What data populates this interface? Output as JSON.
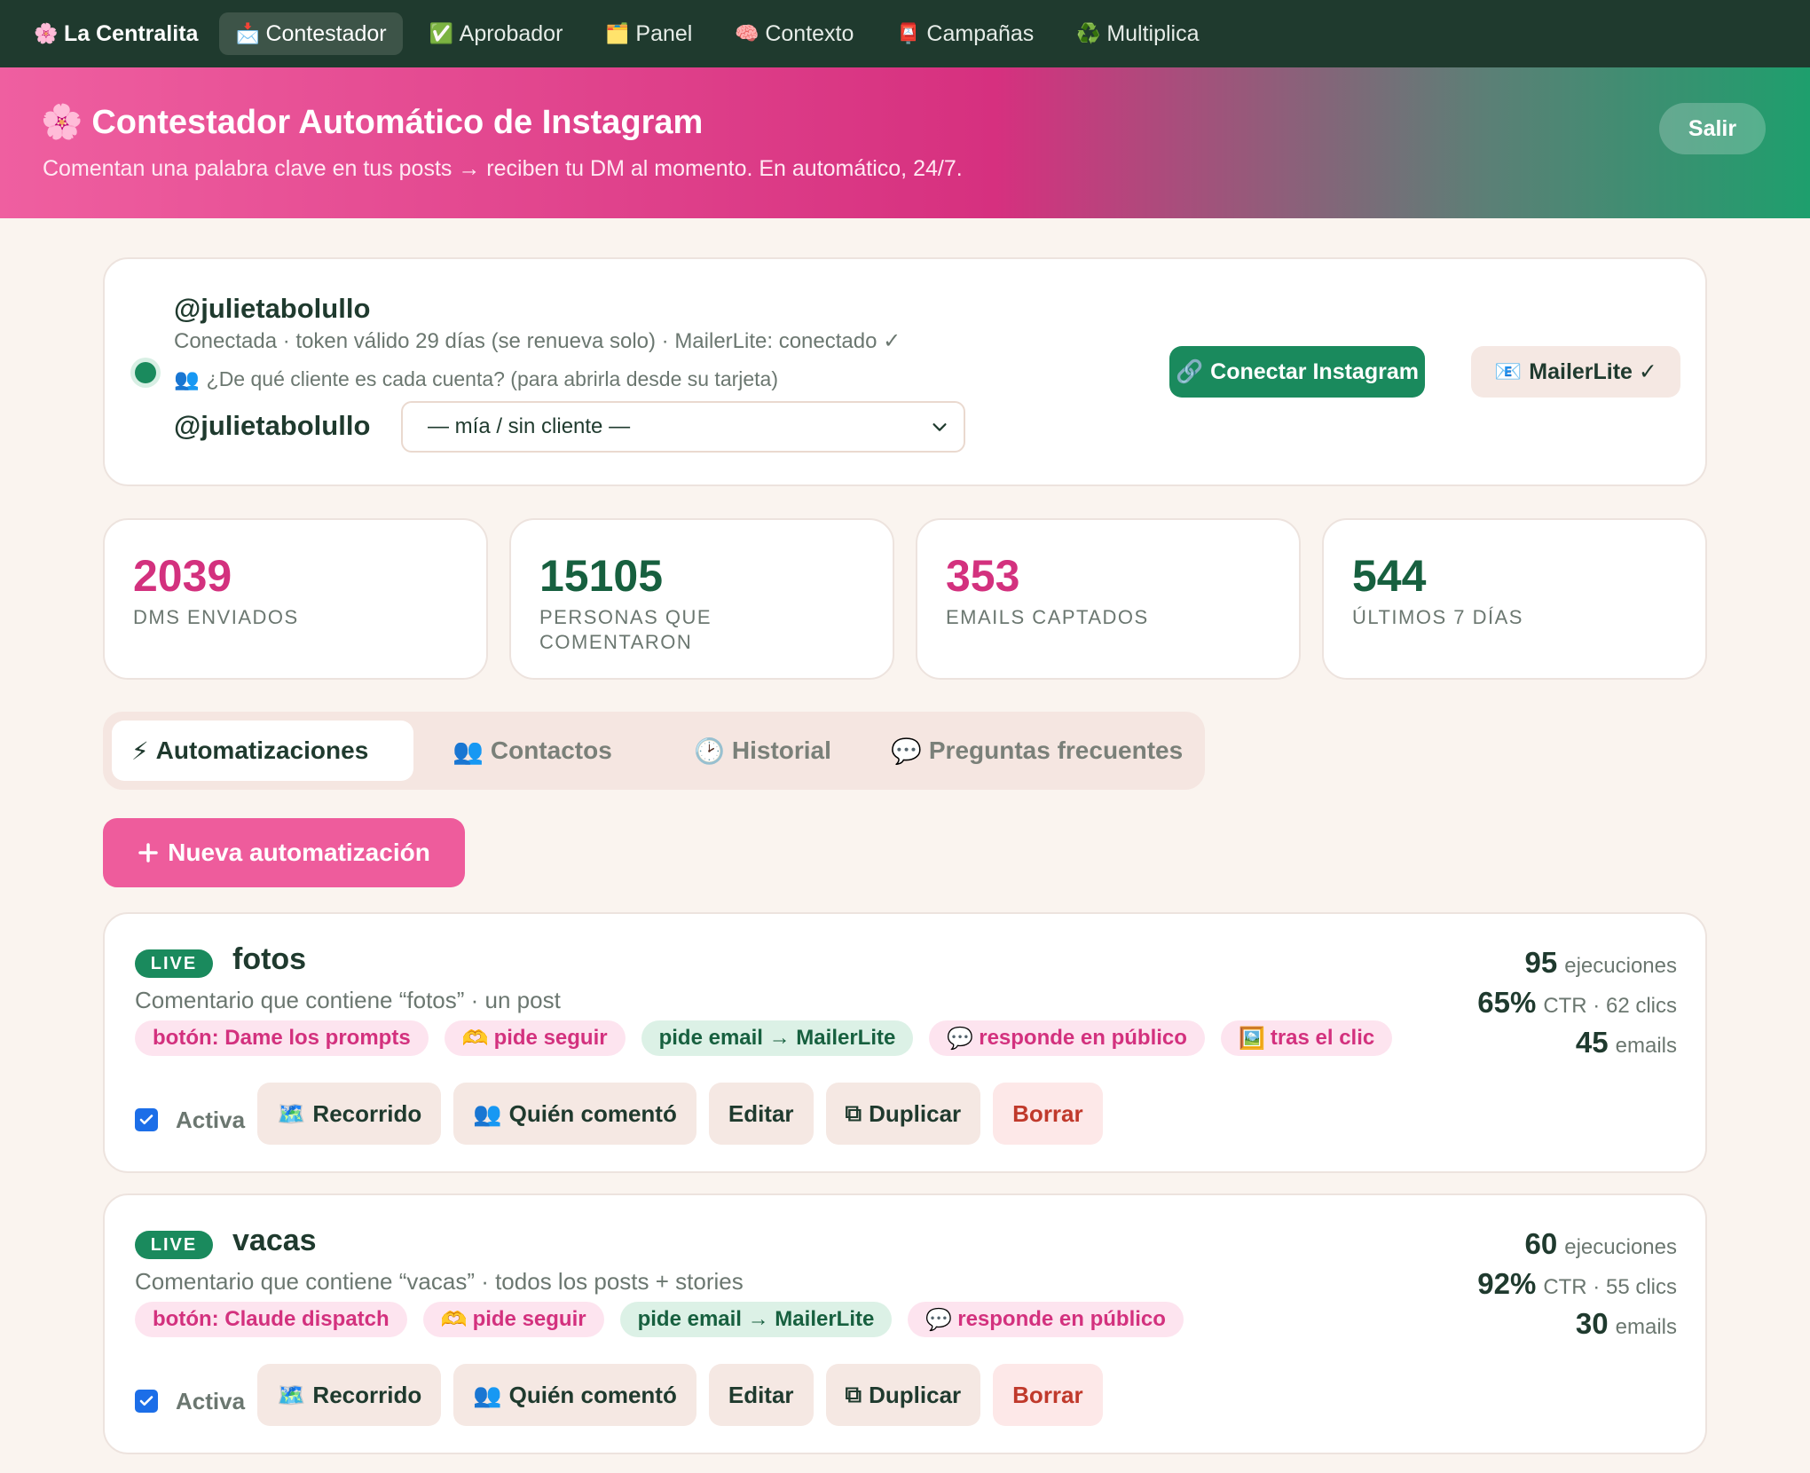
{
  "nav": {
    "brand": {
      "icon": "🌸",
      "label": "La Centralita"
    },
    "tabs": [
      {
        "icon": "📩",
        "label": "Contestador",
        "active": true
      },
      {
        "icon": "✅",
        "label": "Aprobador",
        "active": false
      },
      {
        "icon": "🗂️",
        "label": "Panel",
        "active": false
      },
      {
        "icon": "🧠",
        "label": "Contexto",
        "active": false
      },
      {
        "icon": "📮",
        "label": "Campañas",
        "active": false
      },
      {
        "icon": "♻️",
        "label": "Multiplica",
        "active": false
      }
    ]
  },
  "hero": {
    "icon": "🌸",
    "title": "Contestador Automático de Instagram",
    "subtitle": "Comentan una palabra clave en tus posts → reciben tu DM al momento. En automático, 24/7.",
    "logout_label": "Salir"
  },
  "account": {
    "handle": "@julietabolullo",
    "meta": "Conectada · token válido 29 días (se renueva solo) · MailerLite: conectado ✓",
    "question_icon": "👥",
    "question": "¿De qué cliente es cada cuenta? (para abrirla desde su tarjeta)",
    "row_handle": "@julietabolullo",
    "client_select_value": "— mía / sin cliente —",
    "connect_icon": "🔗",
    "connect_label": "Conectar Instagram",
    "mailer_icon": "📧",
    "mailer_label": "MailerLite ✓",
    "status_color": "#1a8a5d"
  },
  "stats": [
    {
      "value": "2039",
      "label": "DMs enviados",
      "color": "#d3317e"
    },
    {
      "value": "15105",
      "label": "Personas que comentaron",
      "color": "#17603f"
    },
    {
      "value": "353",
      "label": "Emails captados",
      "color": "#d3317e"
    },
    {
      "value": "544",
      "label": "Últimos 7 días",
      "color": "#17603f"
    }
  ],
  "tabs": [
    {
      "icon": "⚡",
      "label": "Automatizaciones",
      "active": true
    },
    {
      "icon": "👥",
      "label": "Contactos",
      "active": false
    },
    {
      "icon": "🕑",
      "label": "Historial",
      "active": false
    },
    {
      "icon": "💬",
      "label": "Preguntas frecuentes",
      "active": false
    }
  ],
  "new_button": {
    "label": "Nueva automatización"
  },
  "automations": [
    {
      "status": "LIVE",
      "name": "fotos",
      "description": "Comentario que contiene “fotos” · un post",
      "chips": [
        {
          "icon": "",
          "label": "botón: Dame los prompts",
          "tone": "pink"
        },
        {
          "icon": "🫶",
          "label": "pide seguir",
          "tone": "pink"
        },
        {
          "icon": "",
          "label": "pide email → MailerLite",
          "tone": "green"
        },
        {
          "icon": "💬",
          "label": "responde en público",
          "tone": "pink"
        },
        {
          "icon": "🖼️",
          "label": "tras el clic",
          "tone": "pink"
        }
      ],
      "active_label": "Activa",
      "active": true,
      "actions": {
        "route": "Recorrido",
        "route_icon": "🗺️",
        "who": "Quién comentó",
        "who_icon": "👥",
        "edit": "Editar",
        "duplicate": "Duplicar",
        "duplicate_icon": "⧉",
        "delete": "Borrar"
      },
      "executions": "95",
      "executions_label": "ejecuciones",
      "ctr": "65%",
      "ctr_label": "CTR · 62 clics",
      "emails": "45",
      "emails_label": "emails"
    },
    {
      "status": "LIVE",
      "name": "vacas",
      "description": "Comentario que contiene “vacas” · todos los posts + stories",
      "chips": [
        {
          "icon": "",
          "label": "botón: Claude dispatch",
          "tone": "pink"
        },
        {
          "icon": "🫶",
          "label": "pide seguir",
          "tone": "pink"
        },
        {
          "icon": "",
          "label": "pide email → MailerLite",
          "tone": "green"
        },
        {
          "icon": "💬",
          "label": "responde en público",
          "tone": "pink"
        }
      ],
      "active_label": "Activa",
      "active": true,
      "actions": {
        "route": "Recorrido",
        "route_icon": "🗺️",
        "who": "Quién comentó",
        "who_icon": "👥",
        "edit": "Editar",
        "duplicate": "Duplicar",
        "duplicate_icon": "⧉",
        "delete": "Borrar"
      },
      "executions": "60",
      "executions_label": "ejecuciones",
      "ctr": "92%",
      "ctr_label": "CTR · 55 clics",
      "emails": "30",
      "emails_label": "emails"
    }
  ]
}
